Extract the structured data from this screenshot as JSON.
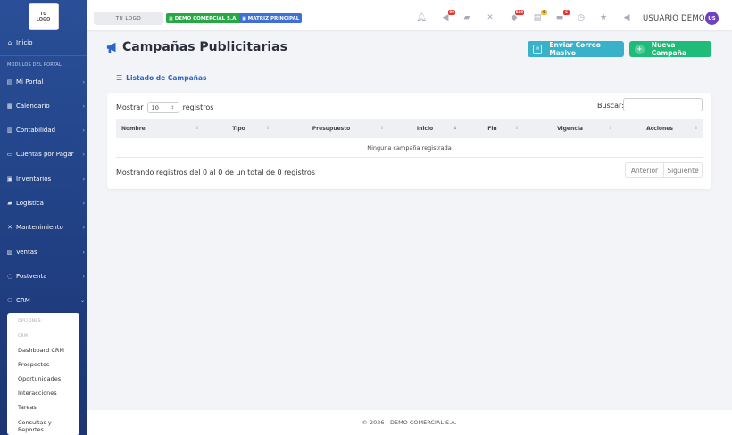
{
  "sidebar": {
    "logo_line1": "TU",
    "logo_line2": "LOGO",
    "home_label": "Inicio",
    "section_label": "MÓDULOS DEL PORTAL",
    "items": [
      {
        "label": "Mi Portal",
        "icon": "file-icon"
      },
      {
        "label": "Calendario",
        "icon": "calendar-icon"
      },
      {
        "label": "Contabilidad",
        "icon": "ledger-icon"
      },
      {
        "label": "Cuentas por Pagar",
        "icon": "money-icon"
      },
      {
        "label": "Inventarios",
        "icon": "boxes-icon"
      },
      {
        "label": "Logística",
        "icon": "truck-icon"
      },
      {
        "label": "Mantenimiento",
        "icon": "tools-icon"
      },
      {
        "label": "Ventas",
        "icon": "cart-icon"
      },
      {
        "label": "Postventa",
        "icon": "headset-icon"
      },
      {
        "label": "CRM",
        "icon": "crm-icon"
      }
    ],
    "submenu": {
      "head_options": "OPCIONES:",
      "head_crm": "CRM",
      "items": [
        "Dashboard CRM",
        "Prospectos",
        "Oportunidades",
        "Interacciones",
        "Tareas",
        "Consultas y Reportes"
      ]
    }
  },
  "topbar": {
    "logo_text": "TU LOGO",
    "company_badge": "DEMO COMERCIAL S.A.",
    "branch_badge": "MATRIZ PRINCIPAL",
    "icons": [
      {
        "name": "bell-icon",
        "count": ""
      },
      {
        "name": "megaphone-icon",
        "count": "99"
      },
      {
        "name": "truck-icon",
        "count": ""
      },
      {
        "name": "tools-icon",
        "count": ""
      },
      {
        "name": "user-alert-icon",
        "count": "580"
      },
      {
        "name": "inbox-icon",
        "count": "0"
      },
      {
        "name": "chat-icon",
        "count": "6"
      },
      {
        "name": "clock-icon",
        "count": ""
      },
      {
        "name": "star-icon",
        "count": ""
      },
      {
        "name": "bullhorn-icon",
        "count": ""
      }
    ],
    "user_name": "USUARIO DEMO",
    "user_initials": "US"
  },
  "page": {
    "title": "Campañas Publicitarias",
    "btn_mass_email": "Enviar Correo Masivo",
    "btn_new_campaign": "Nueva Campaña",
    "list_title": "Listado de Campañas"
  },
  "table": {
    "show_label": "Mostrar",
    "page_size": "10",
    "records_label": "registros",
    "search_label": "Buscar:",
    "search_value": "",
    "columns": [
      "Nombre",
      "Tipo",
      "Presupuesto",
      "Inicio",
      "Fin",
      "Vigencia",
      "Acciones"
    ],
    "empty_message": "Ninguna campaña registrada",
    "info": "Mostrando registros del 0 al 0 de un total de 0 registros",
    "prev_label": "Anterior",
    "next_label": "Siguiente"
  },
  "footer": {
    "text": "© 2026 - DEMO COMERCIAL S.A."
  },
  "colors": {
    "sidebar": "#2a4f98",
    "info_button": "#38b1c9",
    "success_button": "#1fbb78",
    "link": "#2a64c8",
    "avatar": "#6f42c1"
  }
}
